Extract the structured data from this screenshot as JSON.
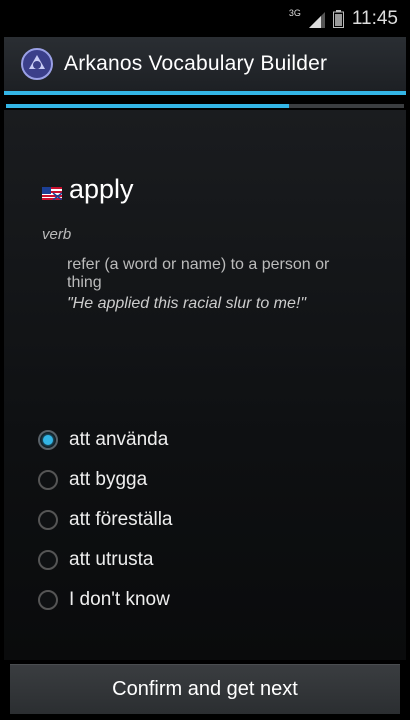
{
  "status_bar": {
    "network": "3G",
    "time": "11:45"
  },
  "app": {
    "title": "Arkanos Vocabulary Builder"
  },
  "progress": {
    "fraction": 0.71
  },
  "card": {
    "word": "apply",
    "part_of_speech": "verb",
    "definition": "refer (a word or name) to a person or thing",
    "example": "\"He applied this racial slur to me!\""
  },
  "options": [
    {
      "label": "att använda",
      "checked": true
    },
    {
      "label": "att bygga",
      "checked": false
    },
    {
      "label": "att föreställa",
      "checked": false
    },
    {
      "label": "att utrusta",
      "checked": false
    },
    {
      "label": "I don't know",
      "checked": false
    }
  ],
  "confirm_button": {
    "label": "Confirm and get next"
  },
  "colors": {
    "accent": "#33b5e5",
    "background": "#000000"
  }
}
